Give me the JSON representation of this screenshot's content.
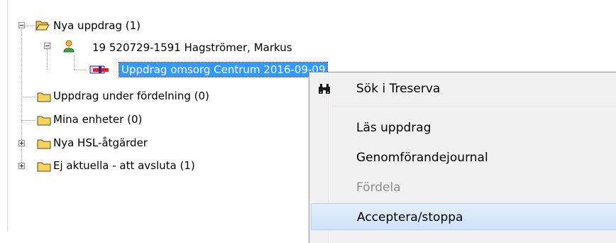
{
  "tree": {
    "items": [
      {
        "label": "Nya uppdrag (1)",
        "icon": "open-folder-icon",
        "expander": "minus"
      },
      {
        "label": "19 520729-1591  Hagströmer, Markus",
        "icon": "person-icon",
        "expander": "minus"
      },
      {
        "label": "Uppdrag omsorg Centrum 2016-09-09",
        "icon": "task-card-icon",
        "selected": true
      },
      {
        "label": "Uppdrag under fördelning (0)",
        "icon": "folder-icon"
      },
      {
        "label": "Mina enheter (0)",
        "icon": "folder-icon"
      },
      {
        "label": "Nya HSL-åtgärder",
        "icon": "folder-icon",
        "expander": "plus"
      },
      {
        "label": "Ej aktuella - att avsluta (1)",
        "icon": "folder-icon",
        "expander": "plus"
      }
    ]
  },
  "context_menu": {
    "items": [
      {
        "label": "Sök i Treserva",
        "icon": "binoculars-icon"
      },
      {
        "label": "Läs uppdrag"
      },
      {
        "label": "Genomförandejournal"
      },
      {
        "label": "Fördela",
        "disabled": true
      },
      {
        "label": "Acceptera/stoppa",
        "highlighted": true
      }
    ]
  },
  "colors": {
    "selection": "#3399ff",
    "folder": "#f5d25c",
    "menu_background": "#f0f0f0",
    "menu_highlight": "#cfe2f8"
  }
}
